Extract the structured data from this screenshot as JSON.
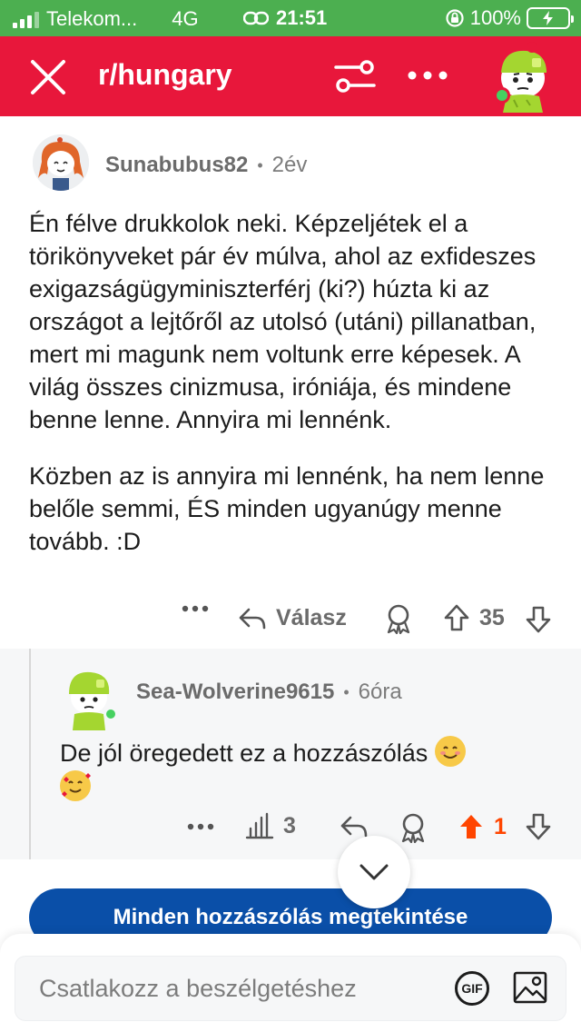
{
  "status_bar": {
    "carrier": "Telekom...",
    "network": "4G",
    "time": "21:51",
    "battery": "100%",
    "bg_color": "#4caf50"
  },
  "header": {
    "title": "r/hungary",
    "bg_color": "#e8173b",
    "close_icon": "close-icon",
    "filter_icon": "sliders-icon",
    "more_icon": "more-icon"
  },
  "comment": {
    "username": "Sunabubus82",
    "separator": "•",
    "age": "2év",
    "paragraphs": [
      "Én félve drukkolok neki. Képzeljétek el a törikönyveket pár év múlva, ahol az exfideszes exigazságügyminiszterférj (ki?) húzta ki az országot a lejtőről az utolsó (utáni) pillanatban, mert mi magunk nem voltunk erre képesek. A világ összes cinizmusa, iróniája, és mindene benne lenne. Annyira mi lennénk.",
      "Közben az is annyira mi lennénk, ha nem lenne belőle semmi, ÉS minden ugyanúgy menne tovább. :D"
    ],
    "actions": {
      "reply_label": "Válasz",
      "vote_count": "35"
    }
  },
  "reply": {
    "username": "Sea-Wolverine9615",
    "separator": "•",
    "age": "6óra",
    "text": "De jól öregedett ez a hozzászólás",
    "actions": {
      "stats_count": "3",
      "vote_count": "1",
      "upvote_color": "#ff4500"
    }
  },
  "view_all_label": "Minden hozzászólás megtekintése",
  "composer": {
    "placeholder": "Csatlakozz a beszélgetéshez",
    "gif_label": "GIF"
  }
}
